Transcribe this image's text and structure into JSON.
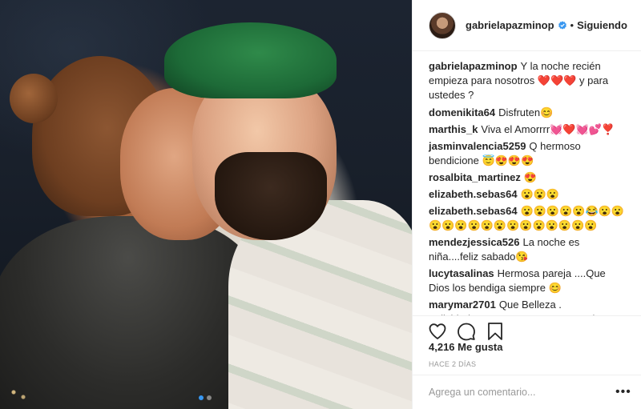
{
  "post": {
    "username": "gabrielapazminop",
    "follow_status": "Siguiendo",
    "separator": "•",
    "likes": "4,216 Me gusta",
    "time_ago": "HACE 2 DÍAS",
    "photo_index": 1,
    "photo_count": 2
  },
  "comments": [
    {
      "user": "gabrielapazminop",
      "text": "Y la noche recién empieza para nosotros ❤️❤️❤️ y para ustedes ?"
    },
    {
      "user": "domenikita64",
      "text": "Disfruten😊"
    },
    {
      "user": "marthis_k",
      "text": "Viva el Amorrrr💓❤️💓💕❣️"
    },
    {
      "user": "jasminvalencia5259",
      "text": "Q hermoso bendicione 😇😍😍😍"
    },
    {
      "user": "rosalbita_martinez",
      "text": "😍"
    },
    {
      "user": "elizabeth.sebas64",
      "text": "😮😮😮"
    },
    {
      "user": "elizabeth.sebas64",
      "text": "😮😮😮😮😮😂😮😮😮😮😮😮😮😮😮😮😮😮😮😮😮"
    },
    {
      "user": "mendezjessica526",
      "text": "La noche es niña....feliz sabado😘"
    },
    {
      "user": "lucytasalinas",
      "text": "Hermosa pareja ....Que Dios los bendiga siempre 😊"
    },
    {
      "user": "marymar2701",
      "text": "Que Belleza . Felicidadessss VIVA EL AMOR. Se los ve lindo"
    }
  ],
  "comment_input": {
    "placeholder": "Agrega un comentario...",
    "value": ""
  },
  "icons": {
    "verified": "verified-badge-icon",
    "like": "heart-icon",
    "comment": "speech-bubble-icon",
    "save": "bookmark-icon",
    "more": "ellipsis-icon"
  },
  "colors": {
    "text": "#262626",
    "muted": "#999999",
    "verified": "#3897f0",
    "border": "#efefef"
  }
}
